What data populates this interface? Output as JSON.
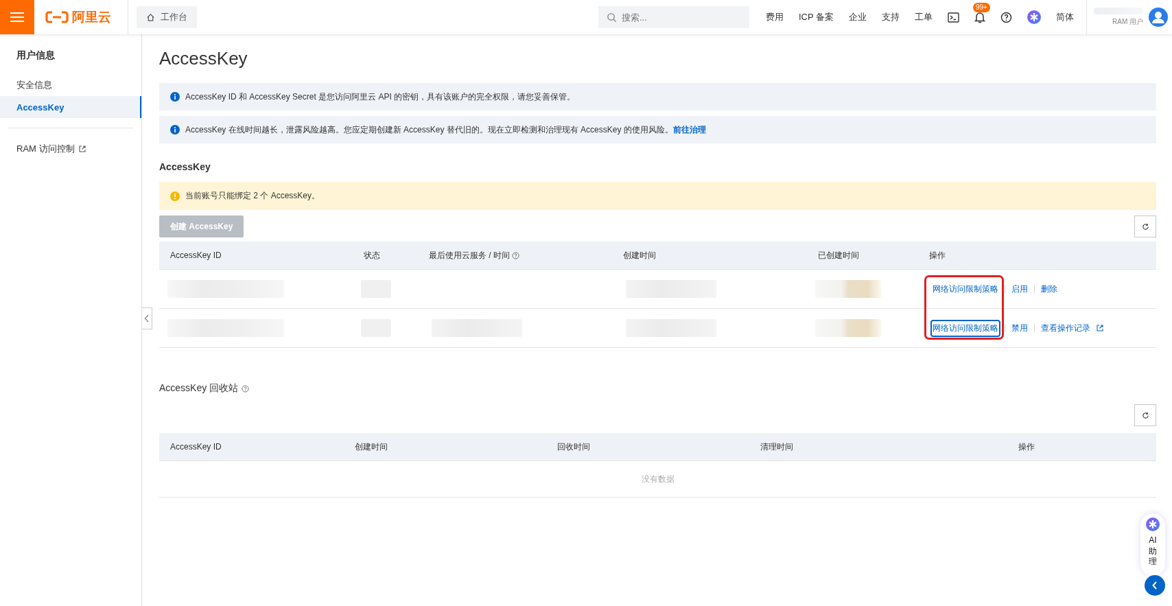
{
  "header": {
    "logo": "阿里云",
    "workbench": "工作台",
    "search": {
      "placeholder": "搜索..."
    },
    "nav": [
      {
        "kind": "link",
        "label": "费用"
      },
      {
        "kind": "link",
        "label": "ICP 备案"
      },
      {
        "kind": "link",
        "label": "企业"
      },
      {
        "kind": "link",
        "label": "支持"
      },
      {
        "kind": "link",
        "label": "工单"
      },
      {
        "kind": "terminal"
      },
      {
        "kind": "bell",
        "badge": "99+"
      },
      {
        "kind": "help"
      },
      {
        "kind": "assistant"
      },
      {
        "kind": "link",
        "label": "简体"
      }
    ],
    "user": {
      "role": "RAM 用户"
    }
  },
  "sidebar": {
    "title": "用户信息",
    "items": [
      {
        "label": "安全信息",
        "selected": false
      },
      {
        "label": "AccessKey",
        "selected": true
      }
    ],
    "links": [
      {
        "label": "RAM 访问控制",
        "external": true
      }
    ]
  },
  "page": {
    "title": "AccessKey",
    "notices": [
      {
        "text": "AccessKey ID 和 AccessKey Secret 是您访问阿里云 API 的密钥，具有该账户的完全权限，请您妥善保管。"
      },
      {
        "text": "AccessKey 在线时间越长，泄露风险越高。您应定期创建新 AccessKey 替代旧的。现在立即检测和治理现有 AccessKey 的使用风险。",
        "link": "前往治理"
      }
    ],
    "keys": {
      "title": "AccessKey",
      "warning": "当前账号只能绑定 2 个 AccessKey。",
      "create_button": {
        "label": "创建 AccessKey",
        "disabled": true
      },
      "columns": [
        {
          "label": "AccessKey ID",
          "help": false
        },
        {
          "label": "状态",
          "help": false
        },
        {
          "label": "最后使用云服务 / 时间",
          "help": true
        },
        {
          "label": "创建时间",
          "help": false
        },
        {
          "label": "已创建时间",
          "help": false
        },
        {
          "label": "操作",
          "help": false
        }
      ],
      "highlight_first_action": true,
      "rows": [
        {
          "last_used_shown": false,
          "actions": [
            {
              "label": "网络访问限制策略",
              "focused": false,
              "external": false
            },
            {
              "label": "启用",
              "focused": false,
              "external": false
            },
            {
              "label": "删除",
              "focused": false,
              "external": false
            }
          ]
        },
        {
          "last_used_shown": true,
          "actions": [
            {
              "label": "网络访问限制策略",
              "focused": true,
              "external": false
            },
            {
              "label": "禁用",
              "focused": false,
              "external": false
            },
            {
              "label": "查看操作记录",
              "focused": false,
              "external": true
            }
          ]
        }
      ]
    },
    "recycle": {
      "title": "AccessKey 回收站",
      "columns": [
        "AccessKey ID",
        "创建时间",
        "回收时间",
        "清理时间",
        "操作"
      ],
      "empty": "没有数据"
    }
  },
  "assistant": {
    "label": "AI 助理"
  }
}
